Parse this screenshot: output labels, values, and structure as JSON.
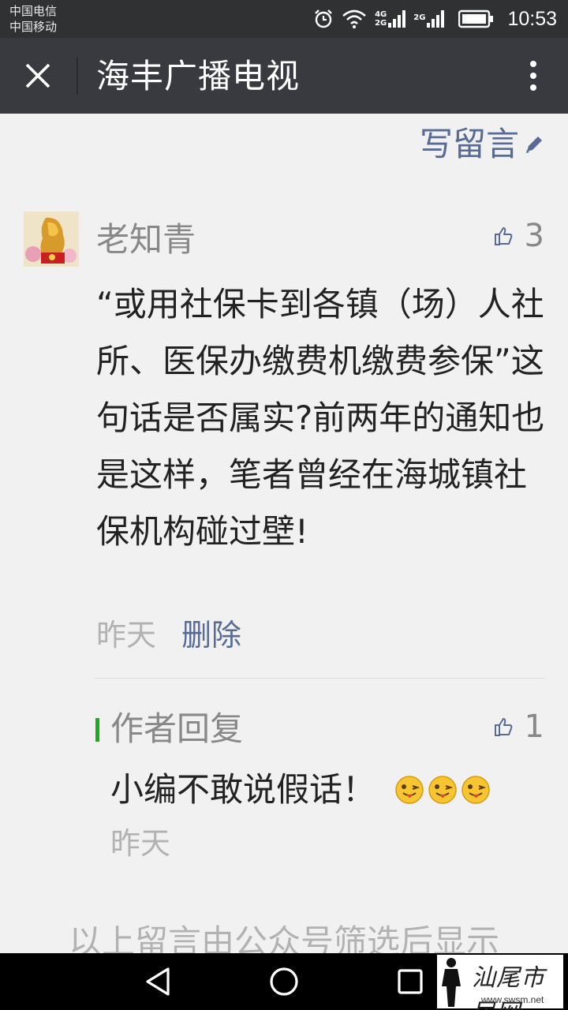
{
  "status_bar": {
    "carrier_1": "中国电信",
    "carrier_2": "中国移动",
    "net_top": "4G",
    "net_bottom": "2G",
    "net_2": "2G",
    "time": "10:53"
  },
  "title_bar": {
    "title": "海丰广播电视",
    "close_icon": "close-icon",
    "more_icon": "more-vertical-icon"
  },
  "write_comment": {
    "label": "写留言",
    "icon": "pencil-icon"
  },
  "comment": {
    "author": "老知青",
    "likes": "3",
    "text": "“或用社保卡到各镇（场）人社所、医保办缴费机缴费参保”这句话是否属实?前两年的通知也是这样，笔者曾经在海城镇社保机构碰过壁!",
    "time": "昨天",
    "delete_label": "删除"
  },
  "reply": {
    "label": "作者回复",
    "likes": "1",
    "text": "小编不敢说假话！",
    "emoji_icon": "winking-tongue-face-icon",
    "time": "昨天"
  },
  "footer_note": "以上留言由公众号筛选后显示",
  "nav_bar": {
    "back_icon": "back-triangle-icon",
    "home_icon": "home-circle-icon",
    "recents_icon": "recents-square-icon"
  },
  "watermark": {
    "title": "汕尾市民网",
    "url": "www.swsm.net"
  },
  "colors": {
    "link": "#576b95",
    "accent_green": "#1aad19",
    "title_bar_bg": "#393a3f",
    "page_bg": "#f1f1f1"
  }
}
